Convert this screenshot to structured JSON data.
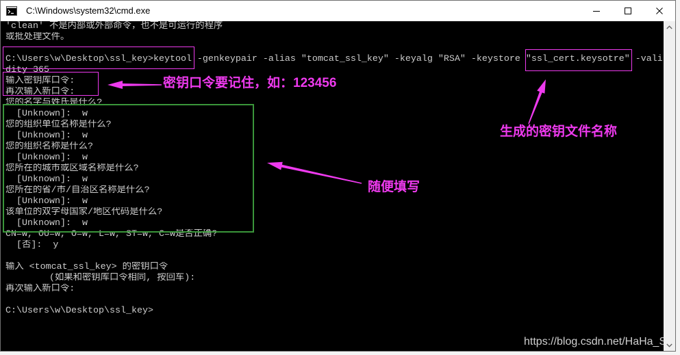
{
  "window": {
    "title": "C:\\Windows\\system32\\cmd.exe",
    "icons": {
      "app": "cmd-icon",
      "minimize": "minimize-icon",
      "maximize": "maximize-icon",
      "close": "close-icon",
      "scroll_up": "chevron-up-icon",
      "scroll_down": "chevron-down-icon"
    }
  },
  "console": {
    "lines": [
      "'clean' 不是内部或外部命令，也不是可运行的程序",
      "或批处理文件。",
      "",
      "C:\\Users\\w\\Desktop\\ssl_key>keytool -genkeypair -alias \"tomcat_ssl_key\" -keyalg \"RSA\" -keystore \"ssl_cert.keysotre\" -vali",
      "dity 365",
      "输入密钥库口令:",
      "再次输入新口令:",
      "您的名字与姓氏是什么?",
      "  [Unknown]:  w",
      "您的组织单位名称是什么?",
      "  [Unknown]:  w",
      "您的组织名称是什么?",
      "  [Unknown]:  w",
      "您所在的城市或区域名称是什么?",
      "  [Unknown]:  w",
      "您所在的省/市/自治区名称是什么?",
      "  [Unknown]:  w",
      "该单位的双字母国家/地区代码是什么?",
      "  [Unknown]:  w",
      "CN=w, OU=w, O=w, L=w, ST=w, C=w是否正确?",
      "  [否]:  y",
      "",
      "输入 <tomcat_ssl_key> 的密钥口令",
      "        (如果和密钥库口令相同, 按回车):",
      "再次输入新口令:",
      "",
      "C:\\Users\\w\\Desktop\\ssl_key>"
    ]
  },
  "annotations": {
    "passphrase_note": "密钥口令要记住，如：123456",
    "keystore_note": "生成的密钥文件名称",
    "fill_in_note": "随便填写"
  },
  "watermark": "https://blog.csdn.net/HaHa_S",
  "colors": {
    "console_bg": "#000000",
    "console_text": "#cccccc",
    "annotation": "#ee3aee",
    "highlight_green": "#3a963a"
  }
}
